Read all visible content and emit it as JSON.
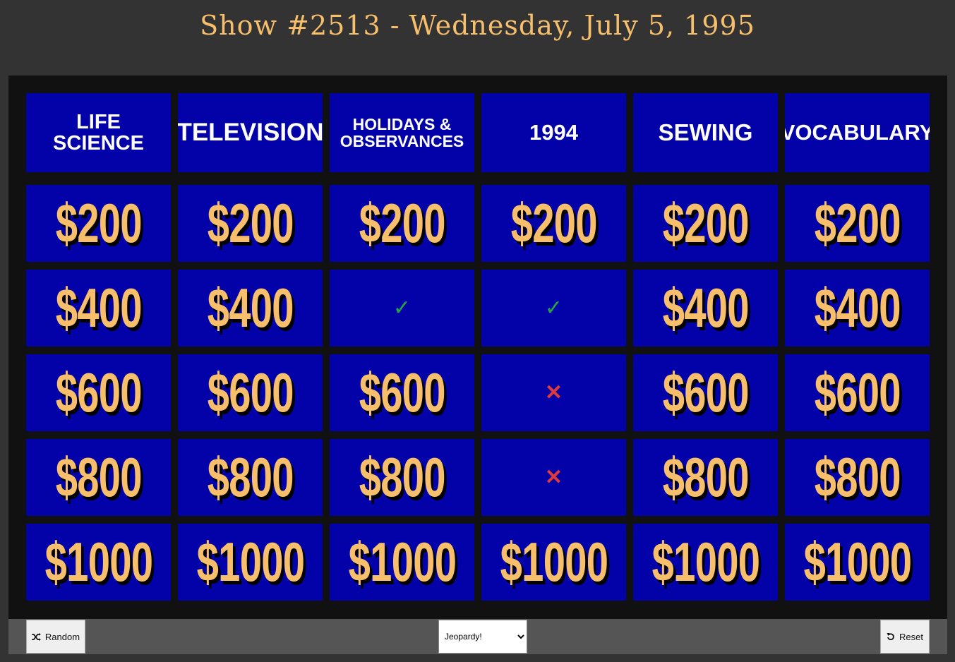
{
  "show_title": "Show #2513 - Wednesday, July 5, 1995",
  "categories": [
    {
      "label": "LIFE SCIENCE"
    },
    {
      "label": "TELEVISION"
    },
    {
      "label": "HOLIDAYS & OBSERVANCES"
    },
    {
      "label": "1994"
    },
    {
      "label": "SEWING"
    },
    {
      "label": "VOCABULARY"
    }
  ],
  "rows": [
    [
      {
        "state": "value",
        "text": "$200"
      },
      {
        "state": "value",
        "text": "$200"
      },
      {
        "state": "value",
        "text": "$200"
      },
      {
        "state": "value",
        "text": "$200"
      },
      {
        "state": "value",
        "text": "$200"
      },
      {
        "state": "value",
        "text": "$200"
      }
    ],
    [
      {
        "state": "value",
        "text": "$400"
      },
      {
        "state": "value",
        "text": "$400"
      },
      {
        "state": "correct",
        "text": "✓"
      },
      {
        "state": "correct",
        "text": "✓"
      },
      {
        "state": "value",
        "text": "$400"
      },
      {
        "state": "value",
        "text": "$400"
      }
    ],
    [
      {
        "state": "value",
        "text": "$600"
      },
      {
        "state": "value",
        "text": "$600"
      },
      {
        "state": "value",
        "text": "$600"
      },
      {
        "state": "incorrect",
        "text": "✕"
      },
      {
        "state": "value",
        "text": "$600"
      },
      {
        "state": "value",
        "text": "$600"
      }
    ],
    [
      {
        "state": "value",
        "text": "$800"
      },
      {
        "state": "value",
        "text": "$800"
      },
      {
        "state": "value",
        "text": "$800"
      },
      {
        "state": "incorrect",
        "text": "✕"
      },
      {
        "state": "value",
        "text": "$800"
      },
      {
        "state": "value",
        "text": "$800"
      }
    ],
    [
      {
        "state": "value",
        "text": "$1000"
      },
      {
        "state": "value",
        "text": "$1000"
      },
      {
        "state": "value",
        "text": "$1000"
      },
      {
        "state": "value",
        "text": "$1000"
      },
      {
        "state": "value",
        "text": "$1000"
      },
      {
        "state": "value",
        "text": "$1000"
      }
    ]
  ],
  "footer": {
    "random_label": "Random",
    "random_icon": "shuffle-icon",
    "round_selected": "Jeopardy!",
    "reset_label": "Reset",
    "reset_icon": "undo-icon"
  },
  "colors": {
    "board_blue": "#0202a8",
    "money_gold": "#f7bf6b",
    "correct_green": "#22aa44",
    "incorrect_red": "#e23a3a"
  }
}
